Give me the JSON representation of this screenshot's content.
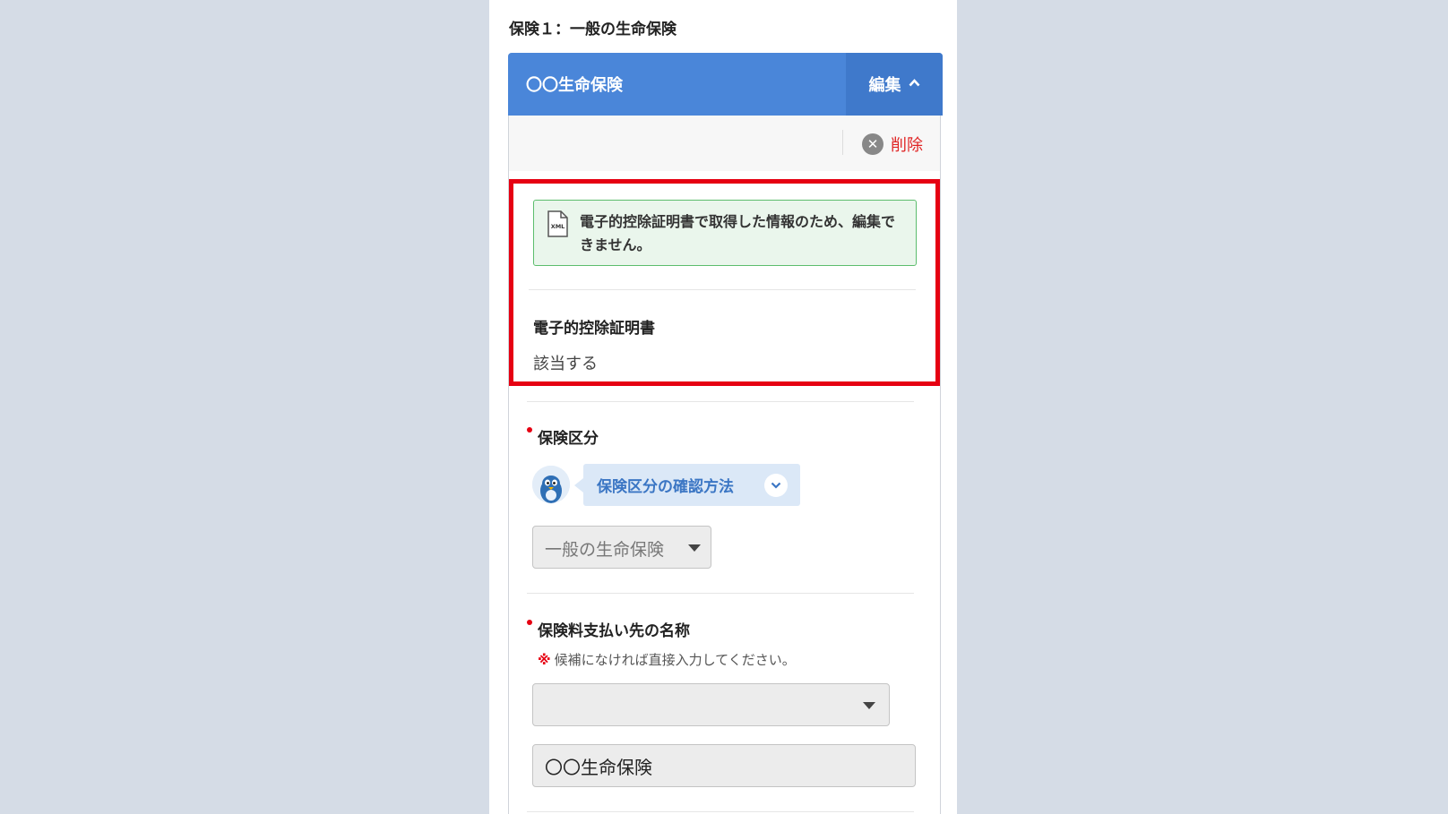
{
  "section_title": "保険１：一般の生命保険",
  "card": {
    "title": "〇〇生命保険",
    "edit_label": "編集",
    "delete_label": "削除"
  },
  "notice": {
    "icon": "xml-file-icon",
    "icon_text": "XML",
    "message": "電子的控除証明書で取得した情報のため、編集できません。"
  },
  "electronic_certificate": {
    "label": "電子的控除証明書",
    "value": "該当する"
  },
  "insurance_category": {
    "label": "保険区分",
    "help_label": "保険区分の確認方法",
    "selected": "一般の生命保険"
  },
  "payee_name": {
    "label": "保険料支払い先の名称",
    "hint_mark": "※",
    "hint": "候補になければ直接入力してください。",
    "select_value": "",
    "input_value": "〇〇生命保険"
  },
  "colors": {
    "header_blue": "#4a86d9",
    "highlight_red": "#e60012",
    "notice_green": "#5cbd6d",
    "delete_red": "#e02424"
  }
}
